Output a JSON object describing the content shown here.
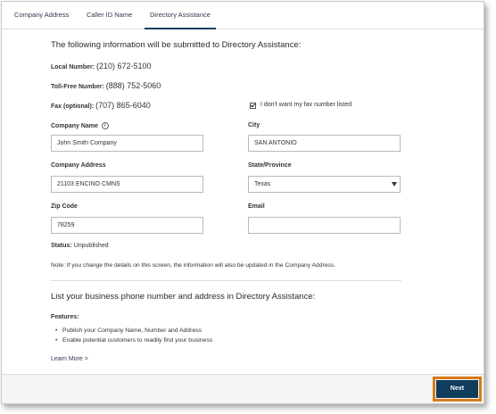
{
  "tabs": [
    {
      "label": "Company Address"
    },
    {
      "label": "Caller ID Name"
    },
    {
      "label": "Directory Assistance"
    }
  ],
  "intro_heading": "The following information will be submitted to Directory Assistance:",
  "numbers": {
    "local": {
      "label": "Local Number:",
      "value": "(210) 672-5100"
    },
    "tollfree": {
      "label": "Toll-Free Number:",
      "value": "(888) 752-5060"
    },
    "fax": {
      "label": "Fax (optional):",
      "value": "(707) 865-6040"
    }
  },
  "fax_checkbox": {
    "label": "I don't want my fax number listed",
    "checked": true
  },
  "form": {
    "company_name": {
      "label": "Company Name",
      "value": "John Smith Company"
    },
    "city": {
      "label": "City",
      "value": "SAN ANTONIO"
    },
    "company_address": {
      "label": "Company Address",
      "value": "21103 ENCINO CMNS"
    },
    "state": {
      "label": "State/Province",
      "value": "Texas"
    },
    "zip": {
      "label": "Zip Code",
      "value": "78259"
    },
    "email": {
      "label": "Email",
      "value": ""
    }
  },
  "status": {
    "label": "Status:",
    "value": "Unpublished"
  },
  "note": "Note: If you change the details on this screen, the information will also be updated in the Company Address.",
  "list_heading": "List your business phone number and address in Directory Assistance:",
  "features": {
    "title": "Features:",
    "items": [
      "Publish your Company Name, Number and Address",
      "Enable potential customers to readily find your business"
    ]
  },
  "learn_more": "Learn More >",
  "next_label": "Next",
  "colors": {
    "accent": "#0f3d5c",
    "highlight": "#d77a1c"
  }
}
